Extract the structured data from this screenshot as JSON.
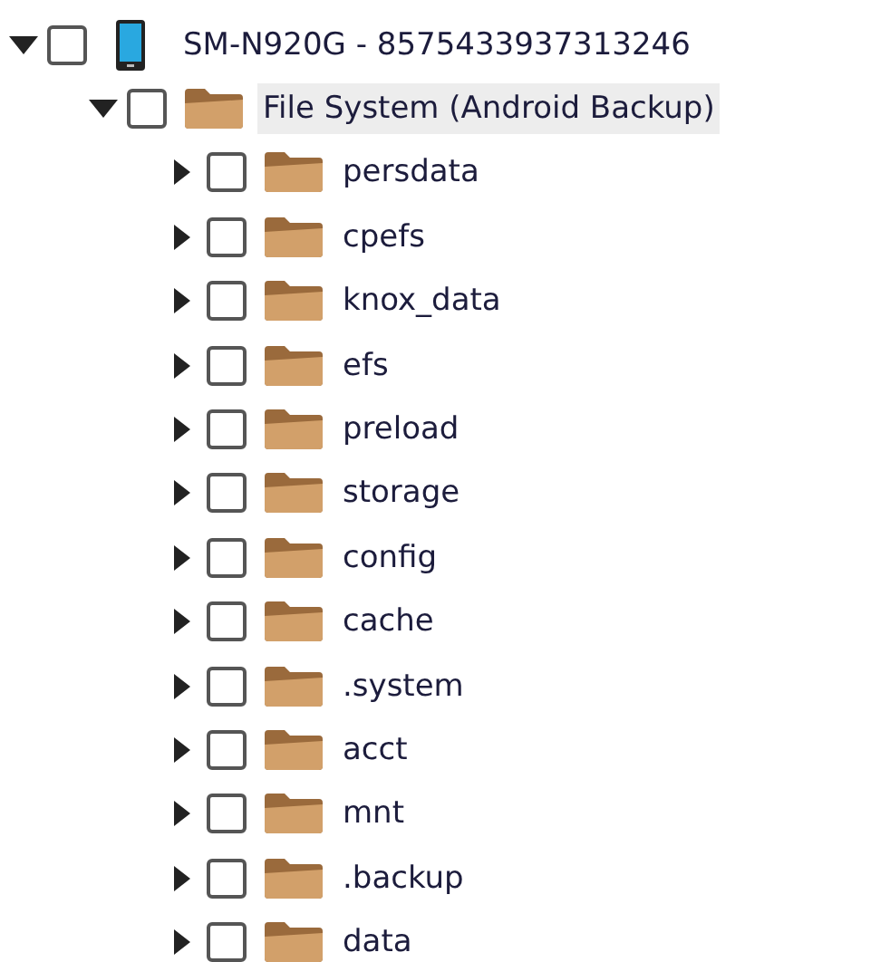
{
  "tree": [
    {
      "label": "SM-N920G - 8575433937313246",
      "kind": "device",
      "expanded": true,
      "checked": false,
      "selected": false,
      "children": [
        {
          "label": "File System (Android Backup)",
          "kind": "folder",
          "expanded": true,
          "checked": false,
          "selected": true,
          "children": [
            {
              "label": "persdata",
              "kind": "folder",
              "expanded": false,
              "checked": false,
              "selected": false
            },
            {
              "label": "cpefs",
              "kind": "folder",
              "expanded": false,
              "checked": false,
              "selected": false
            },
            {
              "label": "knox_data",
              "kind": "folder",
              "expanded": false,
              "checked": false,
              "selected": false
            },
            {
              "label": "efs",
              "kind": "folder",
              "expanded": false,
              "checked": false,
              "selected": false
            },
            {
              "label": "preload",
              "kind": "folder",
              "expanded": false,
              "checked": false,
              "selected": false
            },
            {
              "label": "storage",
              "kind": "folder",
              "expanded": false,
              "checked": false,
              "selected": false
            },
            {
              "label": "config",
              "kind": "folder",
              "expanded": false,
              "checked": false,
              "selected": false
            },
            {
              "label": "cache",
              "kind": "folder",
              "expanded": false,
              "checked": false,
              "selected": false
            },
            {
              "label": ".system",
              "kind": "folder",
              "expanded": false,
              "checked": false,
              "selected": false
            },
            {
              "label": "acct",
              "kind": "folder",
              "expanded": false,
              "checked": false,
              "selected": false
            },
            {
              "label": "mnt",
              "kind": "folder",
              "expanded": false,
              "checked": false,
              "selected": false
            },
            {
              "label": ".backup",
              "kind": "folder",
              "expanded": false,
              "checked": false,
              "selected": false
            },
            {
              "label": "data",
              "kind": "folder",
              "expanded": false,
              "checked": false,
              "selected": false
            }
          ]
        }
      ]
    }
  ]
}
